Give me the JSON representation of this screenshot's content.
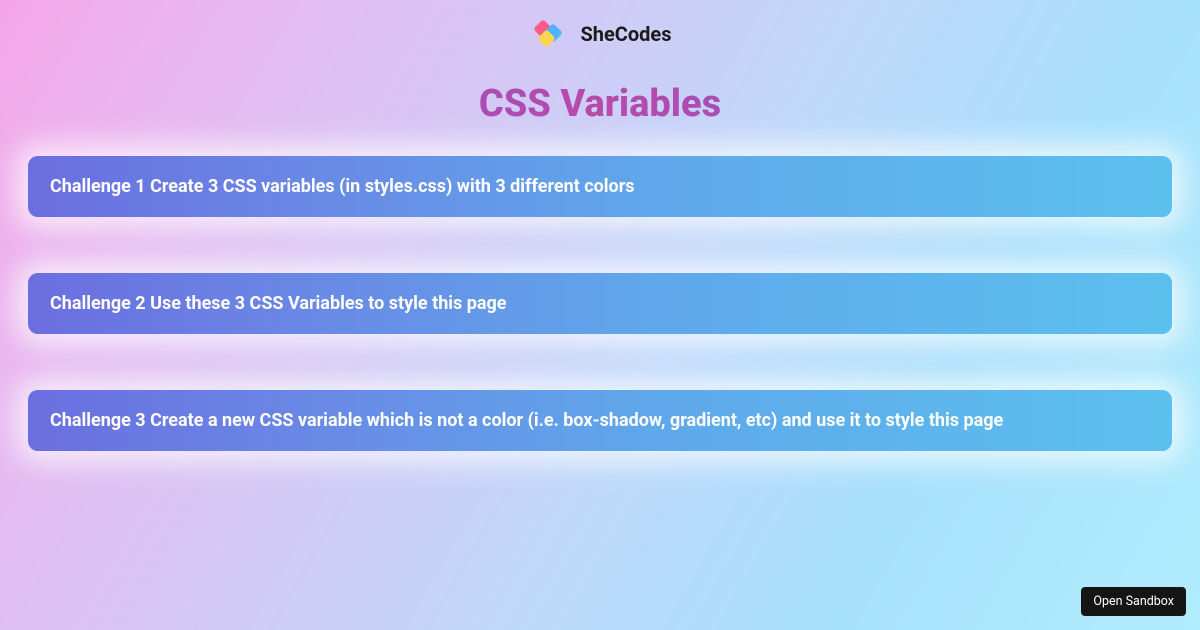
{
  "header": {
    "brand": "SheCodes"
  },
  "title": "CSS Variables",
  "challenges": [
    "Challenge 1 Create 3 CSS variables (in styles.css) with 3 different colors",
    "Challenge 2 Use these 3 CSS Variables to style this page",
    "Challenge 3 Create a new CSS variable which is not a color (i.e. box-shadow, gradient, etc) and use it to style this page"
  ],
  "footer": {
    "sandbox_label": "Open Sandbox"
  }
}
